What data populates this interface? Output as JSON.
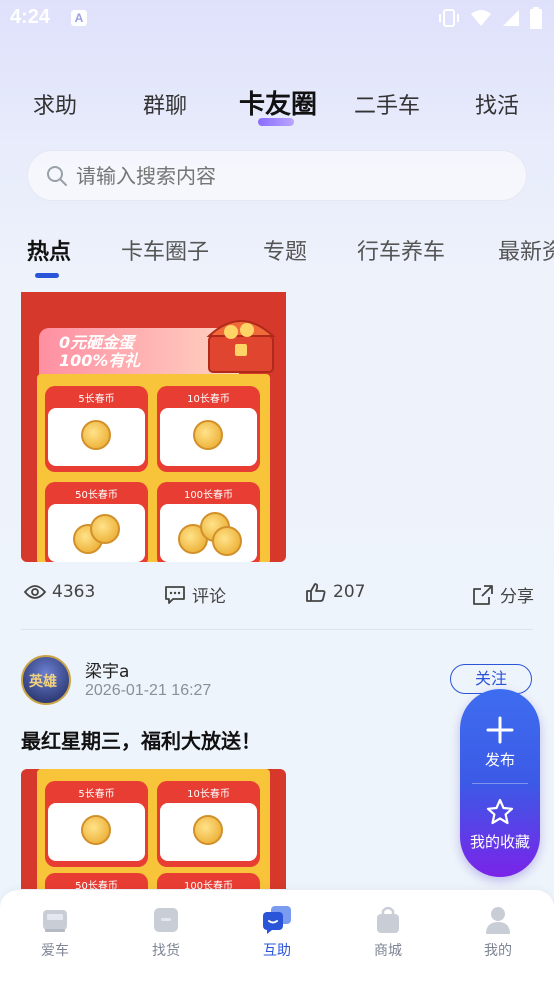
{
  "status_bar": {
    "time": "4:24",
    "indicator": "A"
  },
  "main_tabs": [
    {
      "label": "求助"
    },
    {
      "label": "群聊"
    },
    {
      "label": "卡友圈",
      "active": true
    },
    {
      "label": "二手车"
    },
    {
      "label": "找活"
    }
  ],
  "search": {
    "placeholder": "请输入搜索内容"
  },
  "sub_tabs": [
    {
      "label": "热点",
      "active": true
    },
    {
      "label": "卡车圈子"
    },
    {
      "label": "专题"
    },
    {
      "label": "行车养车"
    },
    {
      "label": "最新资"
    }
  ],
  "post1": {
    "image": {
      "promo_line1": "0元砸金蛋",
      "promo_line2": "100%有礼",
      "coin_cards": [
        "5长春币",
        "10长春币",
        "50长春币",
        "100长春币"
      ]
    },
    "views": "4363",
    "comment_label": "评论",
    "likes": "207",
    "share_label": "分享"
  },
  "post2": {
    "avatar_text": "英雄",
    "author": "梁宇a",
    "time": "2026-01-21 16:27",
    "follow_label": "关注",
    "title": "最红星期三，福利大放送！",
    "image": {
      "coin_cards": [
        "5长春币",
        "10长春币",
        "50长春币",
        "100长春币"
      ]
    }
  },
  "fab": {
    "publish_label": "发布",
    "favorites_label": "我的收藏"
  },
  "bottom_nav": [
    {
      "label": "爱车"
    },
    {
      "label": "找货"
    },
    {
      "label": "互助",
      "active": true
    },
    {
      "label": "商城"
    },
    {
      "label": "我的"
    }
  ],
  "colors": {
    "accent": "#2b55d9",
    "promo_red": "#d6392b",
    "fab_top": "#3e6df0",
    "fab_bottom": "#7a24e8"
  }
}
